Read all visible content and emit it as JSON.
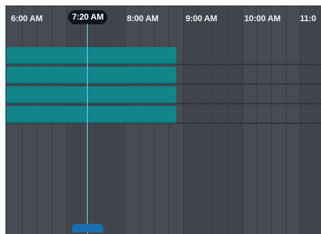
{
  "timeline": {
    "hour_labels": [
      "6:00 AM",
      "8:00 AM",
      "9:00 AM",
      "10:00 AM",
      "11:0"
    ],
    "current_time_label": "7:20 AM",
    "event_count": 4
  },
  "colors": {
    "background": "#474c53",
    "event_bar": "#11858a",
    "now_line": "#7ec3ee",
    "current_time_badge": "#0e1620",
    "scrubber_handle": "#1a6fb0"
  }
}
